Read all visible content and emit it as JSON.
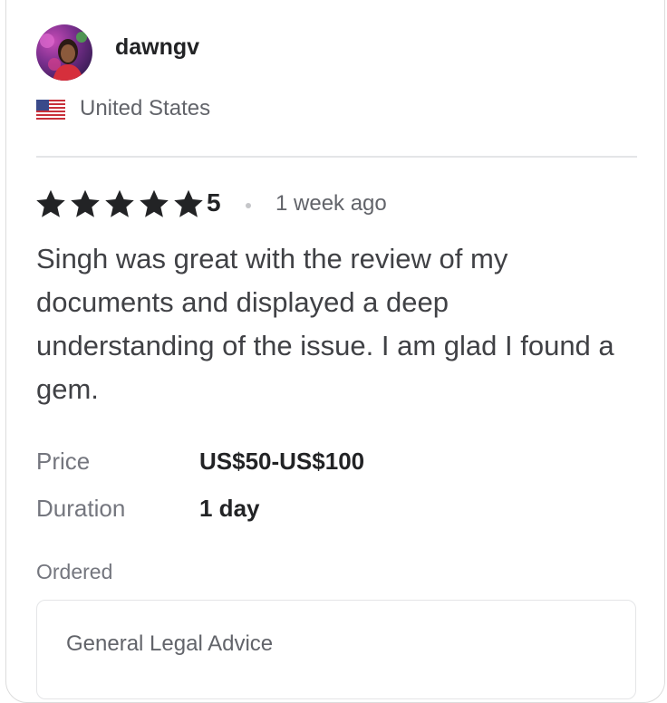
{
  "reviewer": {
    "username": "dawngv",
    "avatar_icon": "user-avatar-photo",
    "country": "United States",
    "flag_icon": "us-flag-icon"
  },
  "review": {
    "rating_stars": 5,
    "rating_value": "5",
    "star_color": "#222325",
    "time_ago": "1 week ago",
    "text": "Singh was great with the review of my documents and displayed a deep understanding of the issue. I am glad I found a gem."
  },
  "details": {
    "price_label": "Price",
    "price_value": "US$50-US$100",
    "duration_label": "Duration",
    "duration_value": "1 day"
  },
  "ordered": {
    "label": "Ordered",
    "item": "General Legal Advice"
  }
}
